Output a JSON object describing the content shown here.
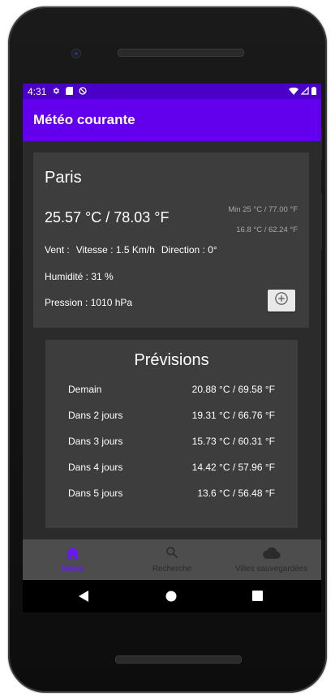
{
  "status_bar": {
    "time": "4:31"
  },
  "app_bar": {
    "title": "Météo courante"
  },
  "current": {
    "city": "Paris",
    "temperature": "25.57 °C / 78.03 °F",
    "min": "Min 25 °C / 77.00 °F",
    "max": "16.8 °C / 62.24 °F",
    "wind_label": "Vent :",
    "wind_speed": "Vitesse : 1.5 Km/h",
    "wind_direction": "Direction : 0°",
    "humidity": "Humidité : 31 %",
    "pressure": "Pression : 1010 hPa"
  },
  "forecast": {
    "title": "Prévisions",
    "rows": [
      {
        "day": "Demain",
        "temp": "20.88 °C / 69.58 °F"
      },
      {
        "day": "Dans 2 jours",
        "temp": "19.31 °C / 66.76 °F"
      },
      {
        "day": "Dans 3 jours",
        "temp": "15.73 °C / 60.31 °F"
      },
      {
        "day": "Dans 4 jours",
        "temp": "14.42 °C / 57.96 °F"
      },
      {
        "day": "Dans 5 jours",
        "temp": "13.6 °C / 56.48 °F"
      }
    ]
  },
  "bottom_nav": {
    "items": [
      {
        "label": "Météo",
        "icon": "home-icon",
        "active": true
      },
      {
        "label": "Recherche",
        "icon": "search-icon",
        "active": false
      },
      {
        "label": "Villes sauvegardées",
        "icon": "cloud-icon",
        "active": false
      }
    ]
  },
  "colors": {
    "accent": "#6200ee",
    "status_bar": "#4a00c7",
    "card": "#3d3d3d",
    "background": "#2b2b2b"
  }
}
